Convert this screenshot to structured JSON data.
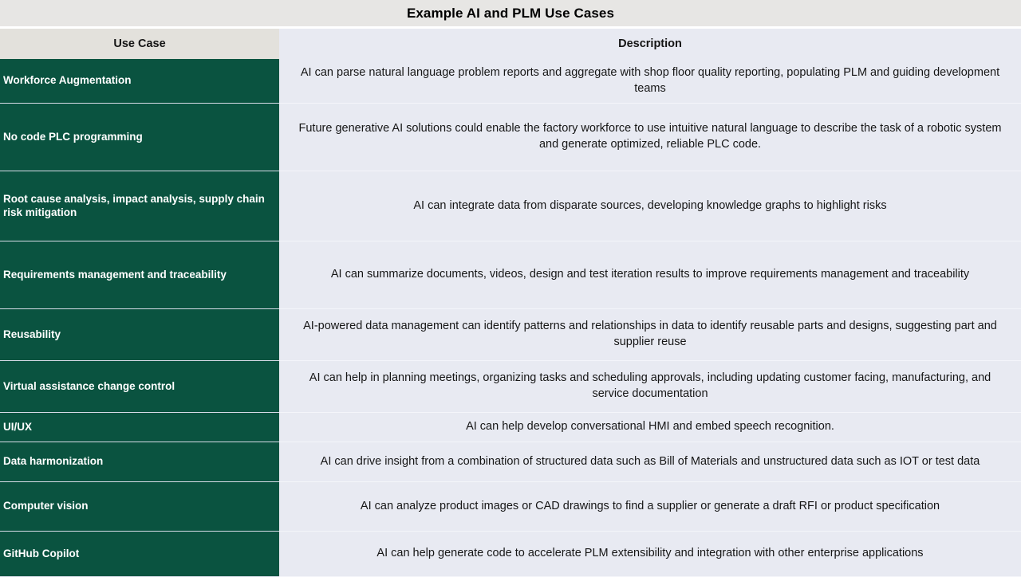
{
  "title": "Example AI and PLM Use Cases",
  "colors": {
    "title_band": "#E7E6E4",
    "use_case_header_bg": "#E3E1DC",
    "description_header_bg": "#E8EAF2",
    "use_case_cell_bg": "#0A5340",
    "use_case_cell_text": "#FFFFFF",
    "description_cell_bg": "#E8EAF2",
    "description_cell_text": "#161616"
  },
  "table": {
    "headers": {
      "use_case": "Use Case",
      "description": "Description"
    },
    "rows": [
      {
        "use_case": "Workforce Augmentation",
        "description": "AI can parse natural language problem reports and aggregate with shop floor quality reporting, populating PLM  and guiding development teams"
      },
      {
        "use_case": "No code PLC programming",
        "description": "Future generative AI solutions could enable the factory workforce to use intuitive natural language to describe the task of a robotic system and generate optimized, reliable PLC code."
      },
      {
        "use_case": "Root cause analysis, impact analysis,  supply chain risk mitigation",
        "description": "AI can integrate data from disparate sources, developing knowledge graphs to highlight risks"
      },
      {
        "use_case": "Requirements management and traceability",
        "description": "AI can summarize documents, videos, design  and test iteration results to  improve  requirements management and traceability"
      },
      {
        "use_case": "Reusability",
        "description": "AI-powered data management can identify  patterns and relationships in data  to identify reusable parts and designs, suggesting part and supplier reuse"
      },
      {
        "use_case": "Virtual assistance change control",
        "description": "AI can help in  planning meetings, organizing tasks and scheduling approvals, including updating customer facing, manufacturing, and service documentation"
      },
      {
        "use_case": "UI/UX",
        "description": "AI can help develop conversational HMI and embed speech recognition."
      },
      {
        "use_case": "Data harmonization",
        "description": "AI can drive insight from a combination of structured data such as Bill of Materials and unstructured data such as IOT or test data"
      },
      {
        "use_case": "Computer vision",
        "description": "AI can analyze product images or CAD drawings to find a supplier or generate a draft  RFI or  product specification"
      },
      {
        "use_case": "GitHub Copilot",
        "description": "AI can help generate code to accelerate PLM extensibility and integration with other enterprise applications"
      }
    ]
  }
}
